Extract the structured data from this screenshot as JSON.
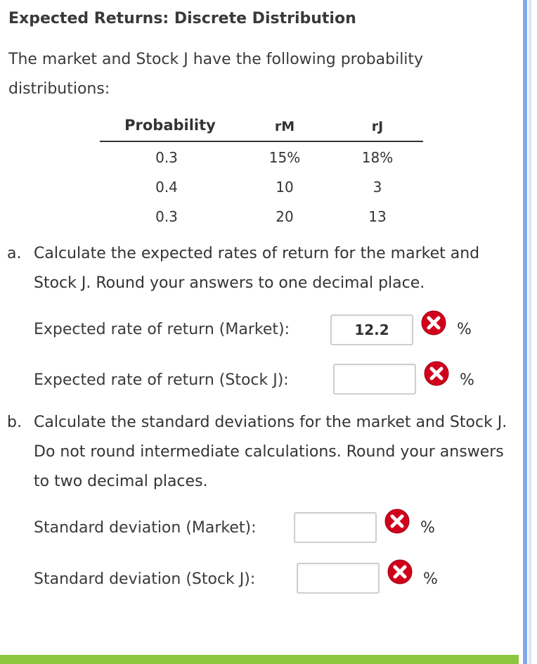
{
  "title": "Expected Returns: Discrete Distribution",
  "intro": "The market and Stock J have the following probability distributions:",
  "table": {
    "headers": {
      "probability": "Probability",
      "rm": "rM",
      "rj": "rJ"
    },
    "rows": [
      {
        "prob": "0.3",
        "rm": "15%",
        "rj": "18%"
      },
      {
        "prob": "0.4",
        "rm": "10",
        "rj": "3"
      },
      {
        "prob": "0.3",
        "rm": "20",
        "rj": "13"
      }
    ]
  },
  "part_a": {
    "letter": "a.",
    "text": "Calculate the expected rates of return for the market and Stock J. Round your answers to one decimal place.",
    "q1_label": "Expected rate of return (Market):",
    "q1_value": "12.2",
    "q2_label": "Expected rate of return (Stock J):",
    "q2_value": "",
    "unit": "%"
  },
  "part_b": {
    "letter": "b.",
    "text": "Calculate the standard deviations for the market and Stock J. Do not round intermediate calculations. Round your answers to two decimal places.",
    "q1_label": "Standard deviation (Market):",
    "q1_value": "",
    "q2_label": "Standard deviation (Stock J):",
    "q2_value": "",
    "unit": "%"
  },
  "colors": {
    "incorrect_icon": "#d0021b",
    "bottom_bar": "#8dc63f",
    "right_rail": "#7fa9ea"
  }
}
